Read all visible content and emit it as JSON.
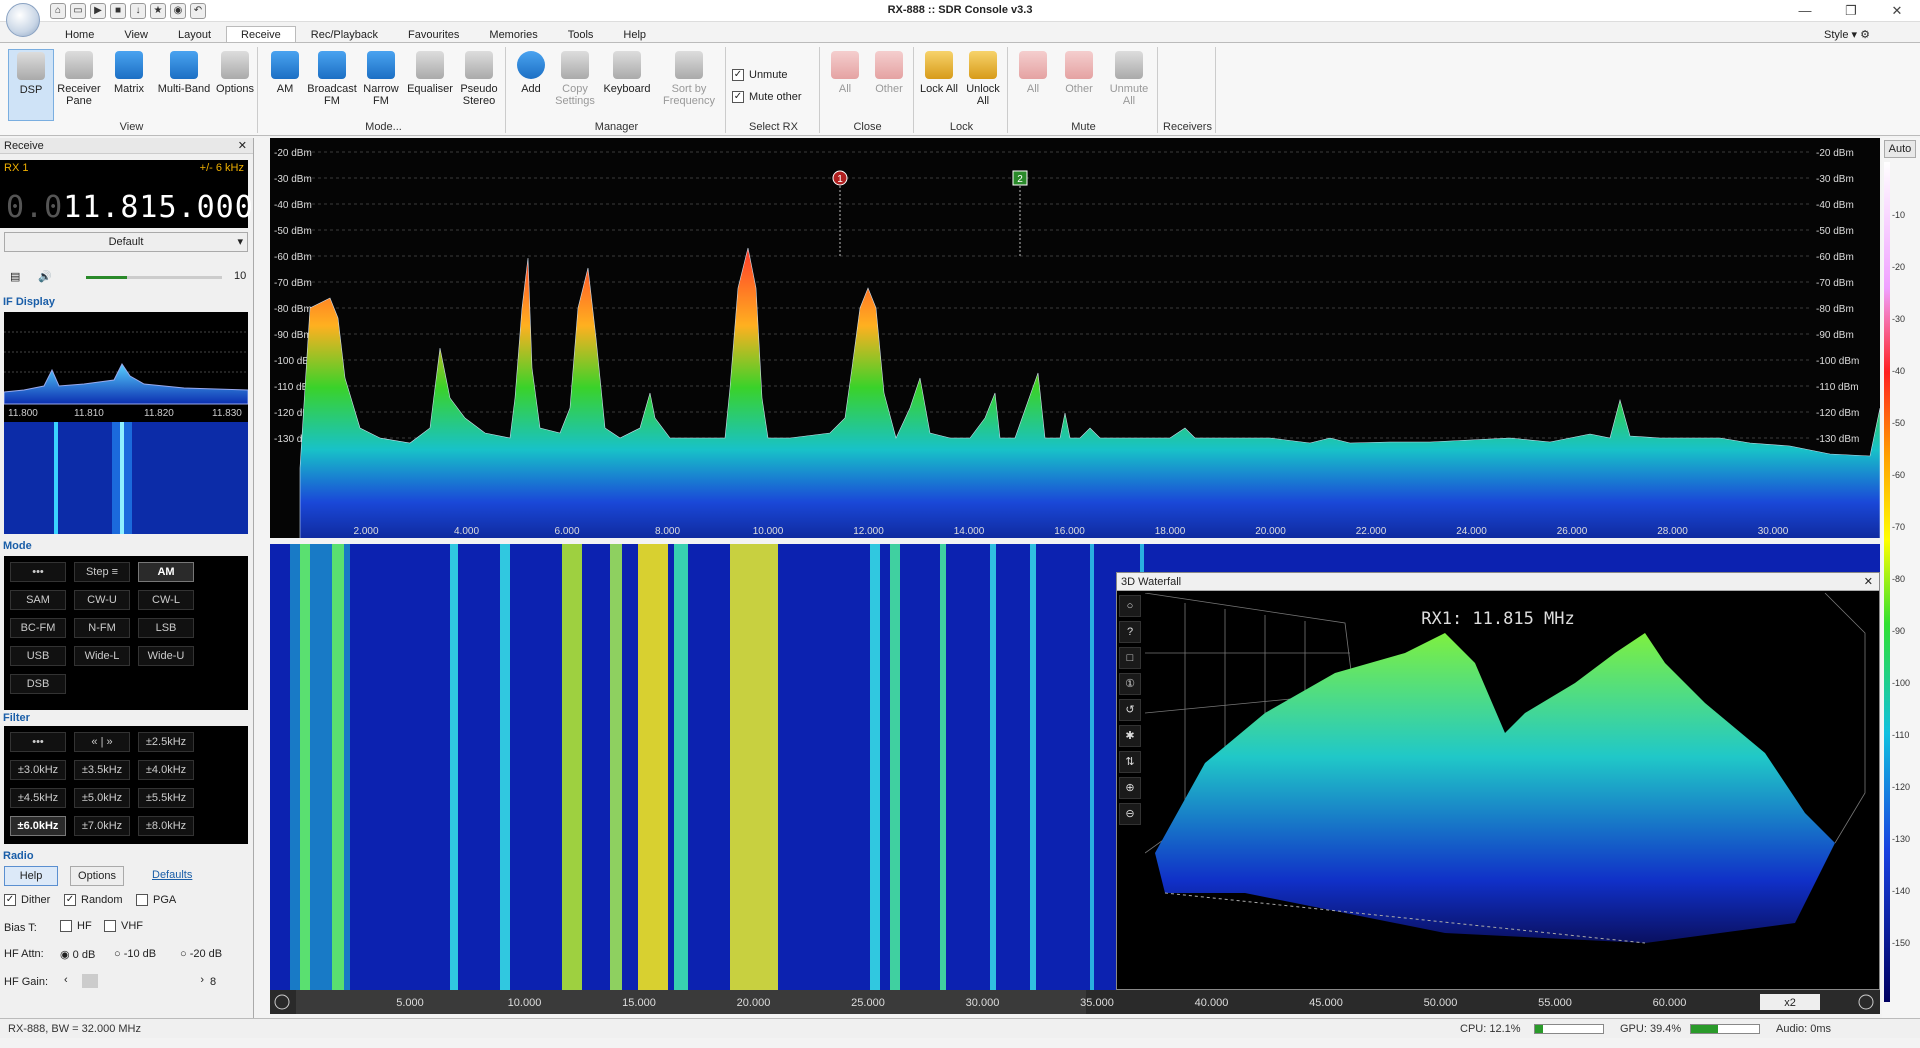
{
  "window": {
    "title": "RX-888 :: SDR Console v3.3"
  },
  "menu_tabs": [
    "Home",
    "View",
    "Layout",
    "Receive",
    "Rec/Playback",
    "Favourites",
    "Memories",
    "Tools",
    "Help"
  ],
  "style_label": "Style",
  "ribbon": {
    "view": {
      "label": "View",
      "buttons": [
        "DSP",
        "Receiver Pane",
        "Matrix",
        "Multi-Band",
        "Options"
      ]
    },
    "mode": {
      "label": "Mode...",
      "buttons": [
        "AM",
        "Broadcast FM",
        "Narrow FM",
        "Equaliser",
        "Pseudo Stereo"
      ]
    },
    "manager": {
      "label": "Manager",
      "buttons": [
        "Add",
        "Copy Settings",
        "Keyboard",
        "Sort by Frequency"
      ]
    },
    "select_rx": {
      "label": "Select RX",
      "unmute": "Unmute",
      "mute_other": "Mute other"
    },
    "close": {
      "label": "Close",
      "buttons": [
        "All",
        "Other"
      ]
    },
    "lock": {
      "label": "Lock",
      "buttons": [
        "Lock All",
        "Unlock All"
      ]
    },
    "mute": {
      "label": "Mute",
      "buttons": [
        "All",
        "Other",
        "Unmute All"
      ]
    },
    "receivers": {
      "label": "Receivers"
    }
  },
  "receive_panel": {
    "title": "Receive",
    "rx_label": "RX 1",
    "bandwidth": "+/- 6 kHz",
    "freq_dim": "0.0",
    "freq_main": "11.815.000",
    "preset": "Default",
    "volume": "10",
    "if_display": {
      "label": "IF Display",
      "ticks": [
        "11.800",
        "11.810",
        "11.820",
        "11.830"
      ]
    },
    "mode_section": "Mode",
    "modes": [
      "•••",
      "Step ≡",
      "AM",
      "SAM",
      "CW-U",
      "CW-L",
      "BC-FM",
      "N-FM",
      "LSB",
      "USB",
      "Wide-L",
      "Wide-U",
      "DSB"
    ],
    "active_mode": "AM",
    "filter_section": "Filter",
    "filters": [
      "•••",
      "« | »",
      "±2.5kHz",
      "±3.0kHz",
      "±3.5kHz",
      "±4.0kHz",
      "±4.5kHz",
      "±5.0kHz",
      "±5.5kHz",
      "±6.0kHz",
      "±7.0kHz",
      "±8.0kHz"
    ],
    "active_filter": "±6.0kHz",
    "radio_section": "Radio",
    "radio_buttons": {
      "help": "Help",
      "options": "Options",
      "defaults": "Defaults"
    },
    "dither": "Dither",
    "random": "Random",
    "pga": "PGA",
    "bias_t": "Bias T:",
    "hf": "HF",
    "vhf": "VHF",
    "hf_attn": "HF Attn:",
    "attn_options": [
      "0 dB",
      "-10 dB",
      "-20 dB"
    ],
    "hf_gain": "HF Gain:",
    "hf_gain_value": "8"
  },
  "spectrum": {
    "db_labels": [
      "-20 dBm",
      "-30 dBm",
      "-40 dBm",
      "-50 dBm",
      "-60 dBm",
      "-70 dBm",
      "-80 dBm",
      "-90 dBm",
      "-100 dBm",
      "-110 dBm",
      "-120 dBm",
      "-130 dBm"
    ],
    "freq_labels": [
      "2.000",
      "4.000",
      "6.000",
      "8.000",
      "10.000",
      "12.000",
      "14.000",
      "16.000",
      "18.000",
      "20.000",
      "22.000",
      "24.000",
      "26.000",
      "28.000",
      "30.000"
    ],
    "markers": [
      "1",
      "2"
    ],
    "auto_label": "Auto"
  },
  "waterfall": {
    "bottom_labels": [
      "5.000",
      "10.000",
      "15.000",
      "20.000",
      "25.000",
      "30.000",
      "35.000",
      "40.000",
      "45.000",
      "50.000",
      "55.000",
      "60.000"
    ],
    "zoom": "x2"
  },
  "waterfall_3d": {
    "title": "3D Waterfall",
    "rx_text": "RX1: 11.815 MHz",
    "tools": [
      "○",
      "?",
      "□",
      "①",
      "↺",
      "✱",
      "⇅",
      "⊕",
      "⊖"
    ]
  },
  "colorbar_labels": [
    "-10",
    "-20",
    "-30",
    "-40",
    "-50",
    "-60",
    "-70",
    "-80",
    "-90",
    "-100",
    "-110",
    "-120",
    "-130",
    "-140",
    "-150"
  ],
  "status": {
    "left": "RX-888, BW = 32.000 MHz",
    "cpu": "CPU: 12.1%",
    "gpu": "GPU: 39.4%",
    "audio": "Audio: 0ms"
  }
}
